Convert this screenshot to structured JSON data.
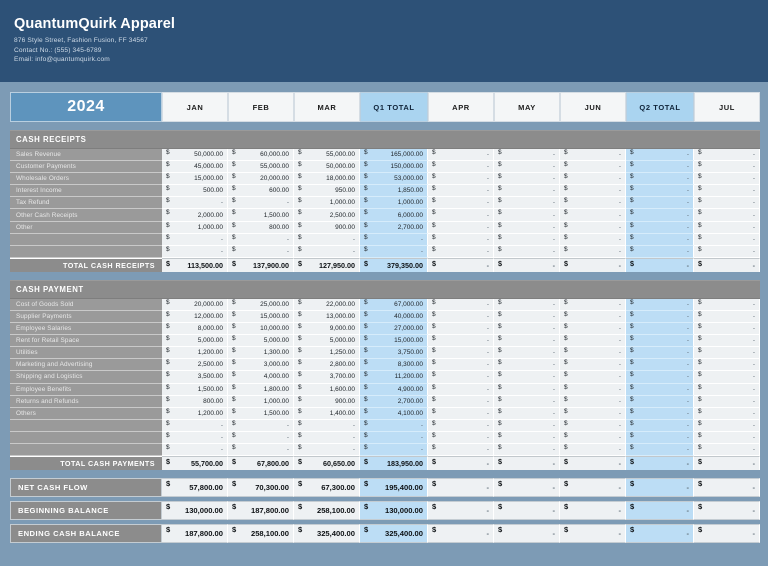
{
  "company": {
    "name": "QuantumQuirk Apparel",
    "address": "876 Style Street, Fashion Fusion, FF 34567",
    "contact": "Contact No.: (555) 345-6789",
    "email": "Email: info@quantumquirk.com"
  },
  "columns": {
    "year": "2024",
    "headers": [
      "JAN",
      "FEB",
      "MAR",
      "Q1 TOTAL",
      "APR",
      "MAY",
      "JUN",
      "Q2 TOTAL",
      "JUL"
    ],
    "total_flags": [
      false,
      false,
      false,
      true,
      false,
      false,
      false,
      true,
      false
    ]
  },
  "currency_symbol": "$",
  "dash": "-",
  "sections": [
    {
      "title": "CASH RECEIPTS",
      "rows": [
        {
          "label": "Sales Revenue",
          "values": [
            "50,000.00",
            "60,000.00",
            "55,000.00",
            "165,000.00",
            "-",
            "-",
            "-",
            "-",
            "-"
          ]
        },
        {
          "label": "Customer Payments",
          "values": [
            "45,000.00",
            "55,000.00",
            "50,000.00",
            "150,000.00",
            "-",
            "-",
            "-",
            "-",
            "-"
          ]
        },
        {
          "label": "Wholesale Orders",
          "values": [
            "15,000.00",
            "20,000.00",
            "18,000.00",
            "53,000.00",
            "-",
            "-",
            "-",
            "-",
            "-"
          ]
        },
        {
          "label": "Interest Income",
          "values": [
            "500.00",
            "600.00",
            "950.00",
            "1,850.00",
            "-",
            "-",
            "-",
            "-",
            "-"
          ]
        },
        {
          "label": "Tax Refund",
          "values": [
            "-",
            "-",
            "1,000.00",
            "1,000.00",
            "-",
            "-",
            "-",
            "-",
            "-"
          ]
        },
        {
          "label": "Other Cash Receipts",
          "values": [
            "2,000.00",
            "1,500.00",
            "2,500.00",
            "6,000.00",
            "-",
            "-",
            "-",
            "-",
            "-"
          ]
        },
        {
          "label": "Other",
          "values": [
            "1,000.00",
            "800.00",
            "900.00",
            "2,700.00",
            "-",
            "-",
            "-",
            "-",
            "-"
          ]
        },
        {
          "label": "",
          "values": [
            "-",
            "-",
            "-",
            "-",
            "-",
            "-",
            "-",
            "-",
            "-"
          ]
        },
        {
          "label": "",
          "values": [
            "-",
            "-",
            "-",
            "-",
            "-",
            "-",
            "-",
            "-",
            "-"
          ]
        }
      ],
      "total": {
        "label": "TOTAL CASH RECEIPTS",
        "values": [
          "113,500.00",
          "137,900.00",
          "127,950.00",
          "379,350.00",
          "-",
          "-",
          "-",
          "-",
          "-"
        ]
      }
    },
    {
      "title": "CASH PAYMENT",
      "rows": [
        {
          "label": "Cost of Goods Sold",
          "values": [
            "20,000.00",
            "25,000.00",
            "22,000.00",
            "67,000.00",
            "-",
            "-",
            "-",
            "-",
            "-"
          ]
        },
        {
          "label": "Supplier Payments",
          "values": [
            "12,000.00",
            "15,000.00",
            "13,000.00",
            "40,000.00",
            "-",
            "-",
            "-",
            "-",
            "-"
          ]
        },
        {
          "label": "Employee Salaries",
          "values": [
            "8,000.00",
            "10,000.00",
            "9,000.00",
            "27,000.00",
            "-",
            "-",
            "-",
            "-",
            "-"
          ]
        },
        {
          "label": "Rent for Retail Space",
          "values": [
            "5,000.00",
            "5,000.00",
            "5,000.00",
            "15,000.00",
            "-",
            "-",
            "-",
            "-",
            "-"
          ]
        },
        {
          "label": "Utilities",
          "values": [
            "1,200.00",
            "1,300.00",
            "1,250.00",
            "3,750.00",
            "-",
            "-",
            "-",
            "-",
            "-"
          ]
        },
        {
          "label": "Marketing and Advertising",
          "values": [
            "2,500.00",
            "3,000.00",
            "2,800.00",
            "8,300.00",
            "-",
            "-",
            "-",
            "-",
            "-"
          ]
        },
        {
          "label": "Shipping and Logistics",
          "values": [
            "3,500.00",
            "4,000.00",
            "3,700.00",
            "11,200.00",
            "-",
            "-",
            "-",
            "-",
            "-"
          ]
        },
        {
          "label": "Employee Benefits",
          "values": [
            "1,500.00",
            "1,800.00",
            "1,600.00",
            "4,900.00",
            "-",
            "-",
            "-",
            "-",
            "-"
          ]
        },
        {
          "label": "Returns and Refunds",
          "values": [
            "800.00",
            "1,000.00",
            "900.00",
            "2,700.00",
            "-",
            "-",
            "-",
            "-",
            "-"
          ]
        },
        {
          "label": "Others",
          "values": [
            "1,200.00",
            "1,500.00",
            "1,400.00",
            "4,100.00",
            "-",
            "-",
            "-",
            "-",
            "-"
          ]
        },
        {
          "label": "",
          "values": [
            "-",
            "-",
            "-",
            "-",
            "-",
            "-",
            "-",
            "-",
            "-"
          ]
        },
        {
          "label": "",
          "values": [
            "-",
            "-",
            "-",
            "-",
            "-",
            "-",
            "-",
            "-",
            "-"
          ]
        },
        {
          "label": "",
          "values": [
            "-",
            "-",
            "-",
            "-",
            "-",
            "-",
            "-",
            "-",
            "-"
          ]
        }
      ],
      "total": {
        "label": "TOTAL CASH PAYMENTS",
        "values": [
          "55,700.00",
          "67,800.00",
          "60,650.00",
          "183,950.00",
          "-",
          "-",
          "-",
          "-",
          "-"
        ]
      }
    }
  ],
  "summary": [
    {
      "label": "NET CASH FLOW",
      "values": [
        "57,800.00",
        "70,300.00",
        "67,300.00",
        "195,400.00",
        "-",
        "-",
        "-",
        "-",
        "-"
      ]
    },
    {
      "label": "BEGINNING BALANCE",
      "values": [
        "130,000.00",
        "187,800.00",
        "258,100.00",
        "130,000.00",
        "-",
        "-",
        "-",
        "-",
        "-"
      ]
    },
    {
      "label": "ENDING CASH BALANCE",
      "values": [
        "187,800.00",
        "258,100.00",
        "325,400.00",
        "325,400.00",
        "-",
        "-",
        "-",
        "-",
        "-"
      ]
    }
  ]
}
